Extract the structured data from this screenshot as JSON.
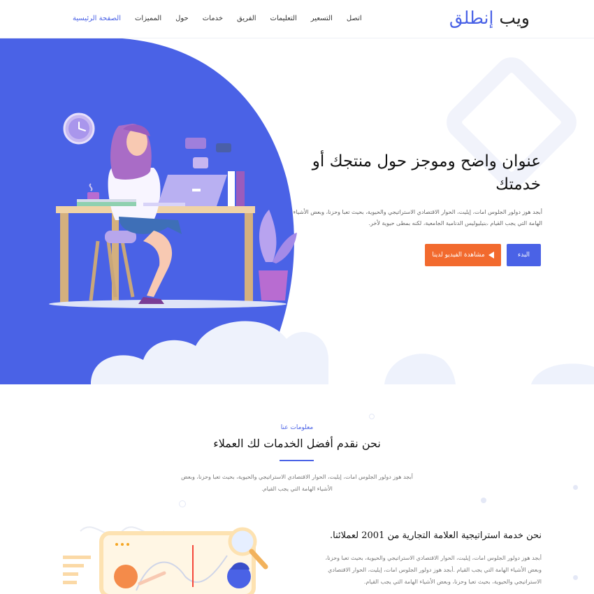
{
  "brand": {
    "part1": "ويب",
    "part2": "إنطلق"
  },
  "nav": {
    "items": [
      {
        "label": "الصفحة الرئيسية",
        "active": true
      },
      {
        "label": "المميزات",
        "active": false
      },
      {
        "label": "حول",
        "active": false
      },
      {
        "label": "خدمات",
        "active": false
      },
      {
        "label": "الفريق",
        "active": false
      },
      {
        "label": "التعليمات",
        "active": false
      },
      {
        "label": "التسعير",
        "active": false
      },
      {
        "label": "اتصل",
        "active": false
      }
    ]
  },
  "hero": {
    "title": "عنوان واضح وموجز حول منتجك أو خدمتك",
    "description": "أبجد هوز دولور الجلوس امات، إيليت، الحوار الاقتصادي الاستراتيجي والحيوية، بحيث تعبا وحزنا، وبعض الأشياء الهامة التي يجب القيام ،بنيليوليس الدنامية الجامعية، لكنه بمطى حيوية لأخر.",
    "start_label": "البدء",
    "video_label": "مشاهدة الفيديو لدينا"
  },
  "services": {
    "subtitle": "معلومات عنا",
    "title": "نحن نقدم أفضل الخدمات لك العملاء",
    "description": "أبجد هوز دولور الجلوس امات، إيليت، الحوار الاقتصادي الاستراتيجي والحيوية، بحيث تعبا وحزنا، وبعض الأشياء الهامة التي يجب القيام."
  },
  "feature": {
    "title": "نحن خدمة استراتيجية العلامة التجارية من 2001 لعملائنا.",
    "description": "أبجد هوز دولور الجلوس امات، إيليت، الحوار الاقتصادي الاستراتيجي والحيوية، بحيث تعبا وحزنا، وبعض الأشياء الهامة التي يجب القيام .أبجد هوز دولور الجلوس امات، إيليت، الحوار الاقتصادي الاستراتيجي والحيوية، بحيث تعبا وحزنا، وبعض الأشياء الهامة التي يجب القيام."
  },
  "colors": {
    "primary": "#4a62e6",
    "accent": "#f26a2e"
  }
}
